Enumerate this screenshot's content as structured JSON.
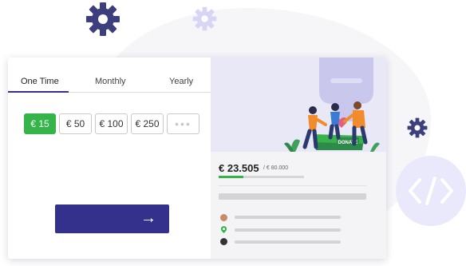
{
  "decor": {
    "gear_dark_icon": "gear-icon",
    "gear_light_icon": "gear-icon",
    "gear_small_icon": "gear-icon",
    "code_icon": "code-brackets-icon",
    "colors": {
      "brand": "#33318c",
      "accent_green": "#34b449",
      "lavender": "#e8e8f7"
    }
  },
  "tabs": [
    {
      "label": "One Time",
      "active": true
    },
    {
      "label": "Monthly",
      "active": false
    },
    {
      "label": "Yearly",
      "active": false
    }
  ],
  "amounts": [
    {
      "label": "€ 15",
      "selected": true
    },
    {
      "label": "€ 50",
      "selected": false
    },
    {
      "label": "€ 100",
      "selected": false
    },
    {
      "label": "€ 250",
      "selected": false
    },
    {
      "label": "•••",
      "selected": false
    }
  ],
  "donate_button": {
    "icon": "arrow-right-icon",
    "label": "→"
  },
  "campaign": {
    "illustration_sign": "DONATE",
    "raised": "€ 23.505",
    "goal": "/ € 80.000",
    "progress": 0.294
  }
}
